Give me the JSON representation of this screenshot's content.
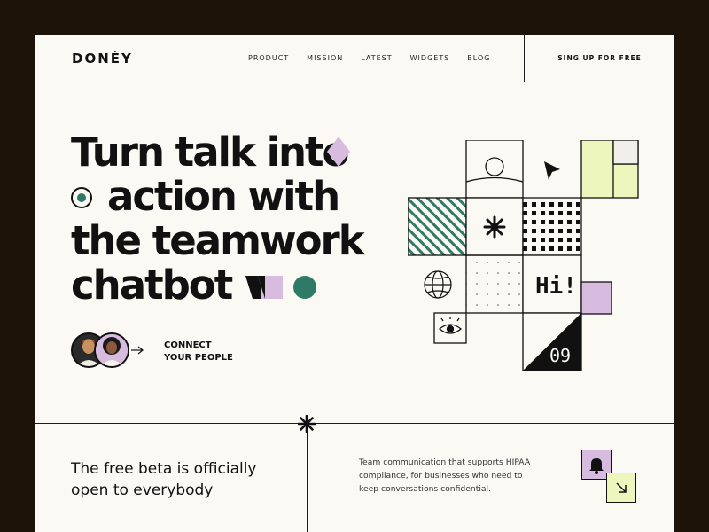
{
  "brand": {
    "logo": "DONÉY"
  },
  "nav": [
    "PRODUCT",
    "MISSION",
    "LATEST",
    "WIDGETS",
    "BLOG"
  ],
  "header": {
    "cta": "SING UP FOR FREE"
  },
  "hero": {
    "line1": "Turn talk into",
    "line2": "action with",
    "line3": "the teamwork",
    "line4": "chatbot",
    "connect_line1": "CONNECT",
    "connect_line2": "YOUR PEOPLE"
  },
  "art": {
    "hi_text": "Hi!",
    "counter": "09"
  },
  "bottom": {
    "beta_line1": "The free beta is officially",
    "beta_line2": "open to everybody",
    "desc_line1": "Team communication that supports HIPAA",
    "desc_line2": "compliance, for businesses who need to",
    "desc_line3": "keep conversations confidential."
  },
  "colors": {
    "frame": "#1e1308",
    "background": "#fbf9f4",
    "accent_green": "#2f7a66",
    "accent_lilac": "#d8bce0",
    "accent_lime": "#ecf6bd"
  },
  "icons": [
    "diamond-icon",
    "target-icon",
    "arrow-right-icon",
    "cursor-icon",
    "globe-icon",
    "eye-icon",
    "star-icon",
    "bell-icon",
    "arrow-down-right-icon"
  ]
}
